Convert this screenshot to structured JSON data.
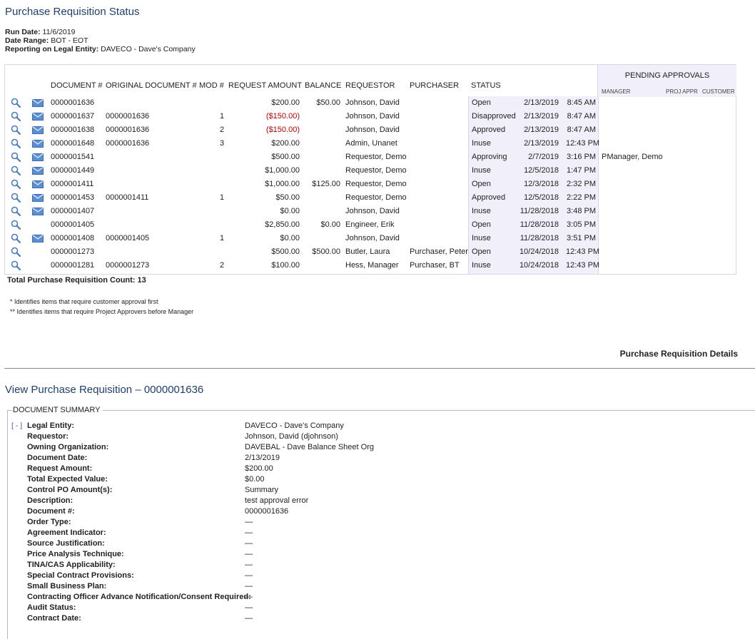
{
  "header": {
    "title": "Purchase Requisition Status",
    "run_date_label": "Run Date:",
    "run_date": "11/6/2019",
    "date_range_label": "Date Range:",
    "date_range": "BOT - EOT",
    "legal_entity_label": "Reporting on Legal Entity:",
    "legal_entity": "DAVECO - Dave's Company"
  },
  "table": {
    "pending_title": "PENDING APPROVALS",
    "pending_sub": [
      "MANAGER",
      "PROJ APPR",
      "CUSTOMER"
    ],
    "columns": [
      "DOCUMENT #",
      "ORIGINAL DOCUMENT #",
      "MOD #",
      "REQUEST AMOUNT",
      "BALANCE",
      "REQUESTOR",
      "PURCHASER",
      "STATUS"
    ],
    "rows": [
      {
        "doc": "0000001636",
        "orig": "",
        "mod": "",
        "amount": "$200.00",
        "neg": false,
        "balance": "$50.00",
        "requestor": "Johnson, David",
        "purchaser": "",
        "status": "Open",
        "date": "2/13/2019",
        "time": "8:45 AM",
        "manager": "",
        "mail": true
      },
      {
        "doc": "0000001637",
        "orig": "0000001636",
        "mod": "1",
        "amount": "($150.00)",
        "neg": true,
        "balance": "",
        "requestor": "Johnson, David",
        "purchaser": "",
        "status": "Disapproved",
        "date": "2/13/2019",
        "time": "8:47 AM",
        "manager": "",
        "mail": true
      },
      {
        "doc": "0000001638",
        "orig": "0000001636",
        "mod": "2",
        "amount": "($150.00)",
        "neg": true,
        "balance": "",
        "requestor": "Johnson, David",
        "purchaser": "",
        "status": "Approved",
        "date": "2/13/2019",
        "time": "8:47 AM",
        "manager": "",
        "mail": true
      },
      {
        "doc": "0000001648",
        "orig": "0000001636",
        "mod": "3",
        "amount": "$200.00",
        "neg": false,
        "balance": "",
        "requestor": "Admin, Unanet",
        "purchaser": "",
        "status": "Inuse",
        "date": "2/13/2019",
        "time": "12:43 PM",
        "manager": "",
        "mail": true
      },
      {
        "doc": "0000001541",
        "orig": "",
        "mod": "",
        "amount": "$500.00",
        "neg": false,
        "balance": "",
        "requestor": "Requestor, Demo",
        "purchaser": "",
        "status": "Approving",
        "date": "2/7/2019",
        "time": "3:16 PM",
        "manager": "PManager, Demo",
        "mail": true
      },
      {
        "doc": "0000001449",
        "orig": "",
        "mod": "",
        "amount": "$1,000.00",
        "neg": false,
        "balance": "",
        "requestor": "Requestor, Demo",
        "purchaser": "",
        "status": "Inuse",
        "date": "12/5/2018",
        "time": "1:47 PM",
        "manager": "",
        "mail": true
      },
      {
        "doc": "0000001411",
        "orig": "",
        "mod": "",
        "amount": "$1,000.00",
        "neg": false,
        "balance": "$125.00",
        "requestor": "Requestor, Demo",
        "purchaser": "",
        "status": "Open",
        "date": "12/3/2018",
        "time": "2:32 PM",
        "manager": "",
        "mail": true
      },
      {
        "doc": "0000001453",
        "orig": "0000001411",
        "mod": "1",
        "amount": "$50.00",
        "neg": false,
        "balance": "",
        "requestor": "Requestor, Demo",
        "purchaser": "",
        "status": "Approved",
        "date": "12/5/2018",
        "time": "2:22 PM",
        "manager": "",
        "mail": true
      },
      {
        "doc": "0000001407",
        "orig": "",
        "mod": "",
        "amount": "$0.00",
        "neg": false,
        "balance": "",
        "requestor": "Johnson, David",
        "purchaser": "",
        "status": "Inuse",
        "date": "11/28/2018",
        "time": "3:48 PM",
        "manager": "",
        "mail": true
      },
      {
        "doc": "0000001405",
        "orig": "",
        "mod": "",
        "amount": "$2,850.00",
        "neg": false,
        "balance": "$0.00",
        "requestor": "Engineer, Erik",
        "purchaser": "",
        "status": "Open",
        "date": "11/28/2018",
        "time": "3:05 PM",
        "manager": "",
        "mail": false
      },
      {
        "doc": "0000001408",
        "orig": "0000001405",
        "mod": "1",
        "amount": "$0.00",
        "neg": false,
        "balance": "",
        "requestor": "Johnson, David",
        "purchaser": "",
        "status": "Inuse",
        "date": "11/28/2018",
        "time": "3:51 PM",
        "manager": "",
        "mail": true
      },
      {
        "doc": "0000001273",
        "orig": "",
        "mod": "",
        "amount": "$500.00",
        "neg": false,
        "balance": "$500.00",
        "requestor": "Butler, Laura",
        "purchaser": "Purchaser, Peter",
        "status": "Open",
        "date": "10/24/2018",
        "time": "12:43 PM",
        "manager": "",
        "mail": false
      },
      {
        "doc": "0000001281",
        "orig": "0000001273",
        "mod": "2",
        "amount": "$100.00",
        "neg": false,
        "balance": "",
        "requestor": "Hess, Manager",
        "purchaser": "Purchaser, BT",
        "status": "Inuse",
        "date": "10/24/2018",
        "time": "12:43 PM",
        "manager": "",
        "mail": false
      }
    ],
    "total_label": "Total Purchase Requisition Count: 13"
  },
  "notes": [
    "*  Identifies items that require customer approval first",
    "**  Identifies items that require Project Approvers before Manager"
  ],
  "details_link": "Purchase Requisition Details",
  "view": {
    "title": "View Purchase Requisition – 0000001636",
    "legend": "DOCUMENT SUMMARY",
    "toggle": "[ - ]",
    "fields": [
      {
        "label": "Legal Entity:",
        "value": "DAVECO - Dave's Company"
      },
      {
        "label": "Requestor:",
        "value": "Johnson, David (djohnson)"
      },
      {
        "label": "Owning Organization:",
        "value": "DAVEBAL - Dave Balance Sheet Org"
      },
      {
        "label": "Document Date:",
        "value": "2/13/2019"
      },
      {
        "label": "Request Amount:",
        "value": "$200.00"
      },
      {
        "label": "Total Expected Value:",
        "value": "$0.00"
      },
      {
        "label": "Control PO Amount(s):",
        "value": "Summary"
      },
      {
        "label": "Description:",
        "value": "test approval error"
      },
      {
        "label": "Document #:",
        "value": "0000001636"
      },
      {
        "label": "Order Type:",
        "value": "—"
      },
      {
        "label": "Agreement Indicator:",
        "value": "—"
      },
      {
        "label": "Source Justification:",
        "value": "—"
      },
      {
        "label": "Price Analysis Technique:",
        "value": "—"
      },
      {
        "label": "TINA/CAS Applicability:",
        "value": "—"
      },
      {
        "label": "Special Contract Provisions:",
        "value": "—"
      },
      {
        "label": "Small Business Plan:",
        "value": "—"
      },
      {
        "label": "Contracting Officer Advance Notification/Consent Required:",
        "value": "—"
      },
      {
        "label": "Audit Status:",
        "value": "—"
      },
      {
        "label": "Contract Date:",
        "value": "—"
      }
    ]
  }
}
